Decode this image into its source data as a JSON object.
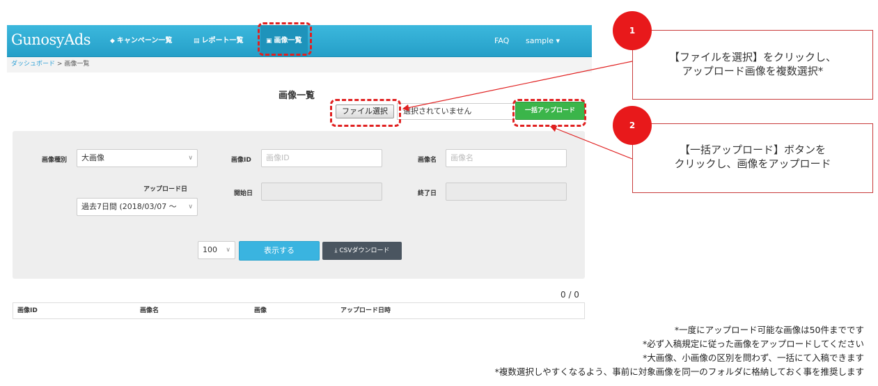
{
  "navbar": {
    "brand": "GunosyAds",
    "items": [
      {
        "icon": "tag-icon",
        "label": "キャンペーン一覧"
      },
      {
        "icon": "list-icon",
        "label": "レポート一覧"
      },
      {
        "icon": "image-icon",
        "label": "画像一覧"
      }
    ],
    "faq": "FAQ",
    "user": "sample ▾"
  },
  "breadcrumb": {
    "link": "ダッシュボード",
    "separator": ">",
    "current": "画像一覧"
  },
  "page_title": "画像一覧",
  "upload": {
    "file_button": "ファイル選択",
    "file_status": "選択されていません",
    "bulk_upload_button": "一括アップロード"
  },
  "filters": {
    "image_type_label": "画像種別",
    "image_type_value": "大画像",
    "image_id_label": "画像ID",
    "image_id_placeholder": "画像ID",
    "image_name_label": "画像名",
    "image_name_placeholder": "画像名",
    "upload_date_label": "アップロード日",
    "upload_date_value": "過去7日間 (2018/03/07 ～",
    "start_date_label": "開始日",
    "end_date_label": "終了日",
    "per_page_value": "100",
    "show_button": "表示する",
    "csv_button": "CSVダウンロード"
  },
  "results": {
    "count": "0 / 0",
    "columns": [
      "画像ID",
      "画像名",
      "画像",
      "アップロード日時"
    ]
  },
  "callouts": [
    {
      "number": "1",
      "text_line1": "【ファイルを選択】をクリックし、",
      "text_line2": "アップロード画像を複数選択*"
    },
    {
      "number": "2",
      "text_line1": "【一括アップロード】ボタンを",
      "text_line2": "クリックし、画像をアップロード"
    }
  ],
  "notes": [
    "*一度にアップロード可能な画像は50件までです",
    "*必ず入稿規定に従った画像をアップロードしてください",
    "*大画像、小画像の区別を問わず、一括にて入稿できます",
    "*複数選択しやすくなるよう、事前に対象画像を同一のフォルダに格納しておく事を推奨します"
  ],
  "colors": {
    "navbar": "#259fc8",
    "bulk_upload": "#3bb54a",
    "show_button": "#3ab4e0",
    "csv_button": "#4a5560",
    "annotation": "#e02020"
  }
}
